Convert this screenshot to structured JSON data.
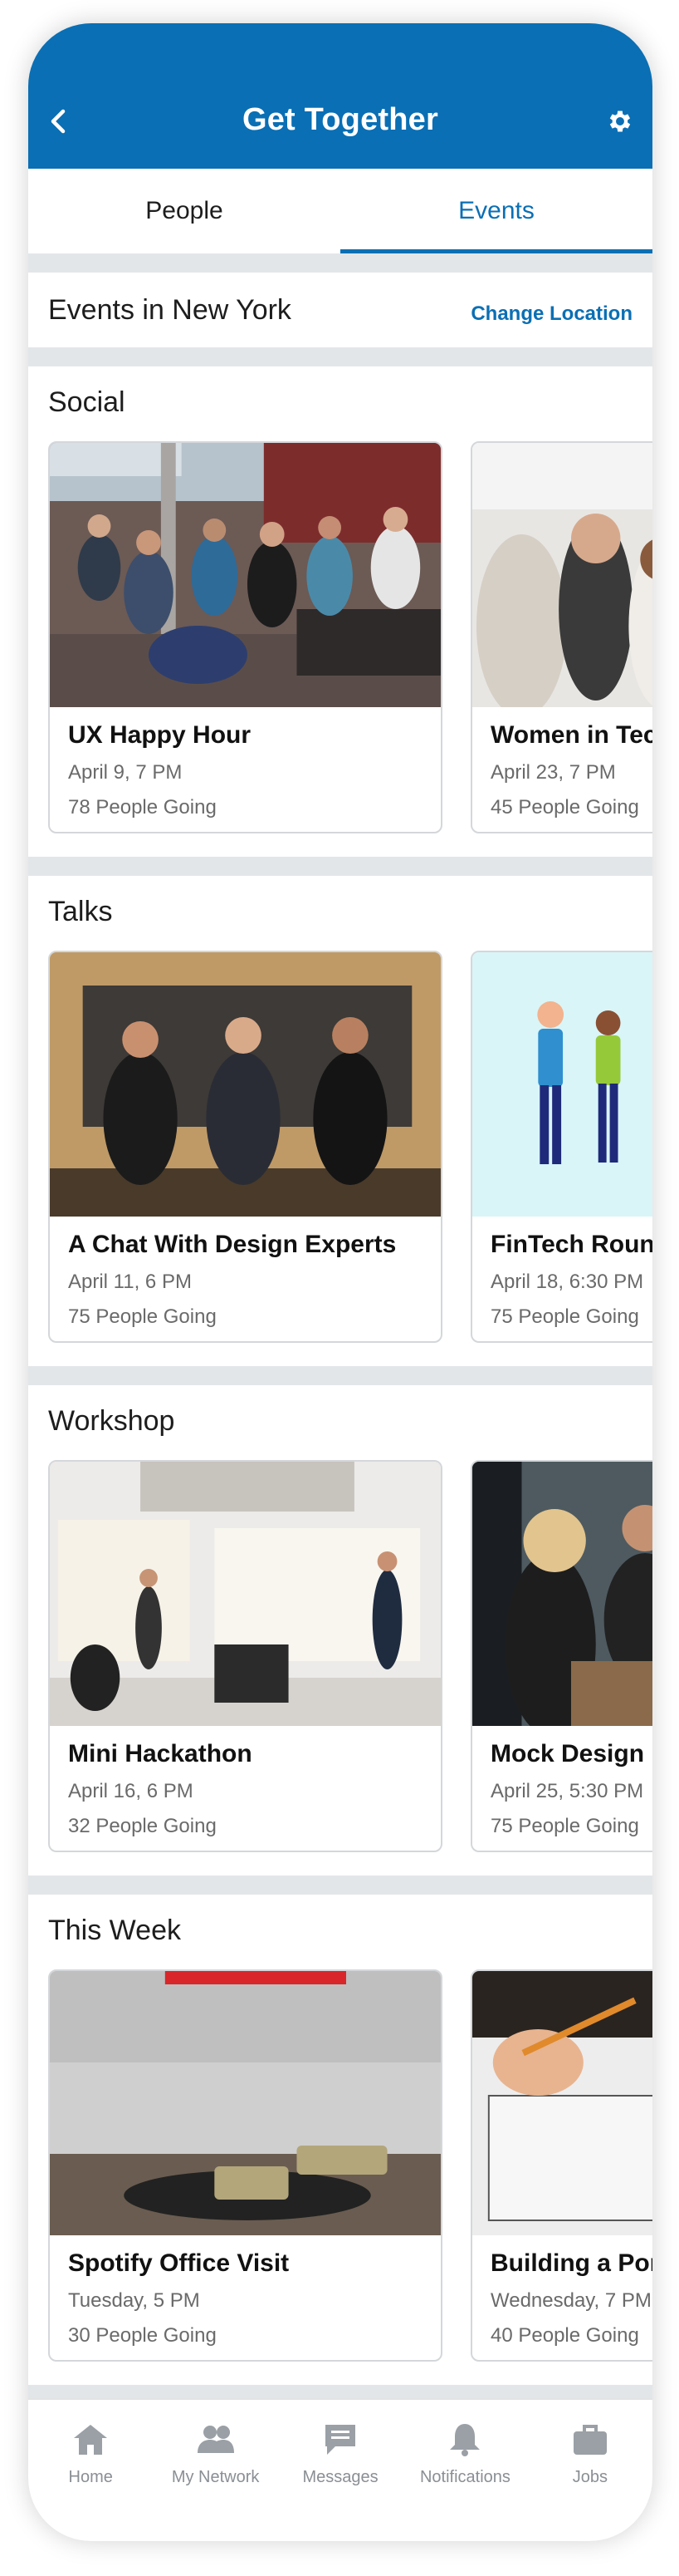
{
  "header": {
    "title": "Get Together"
  },
  "tabs": [
    {
      "label": "People"
    },
    {
      "label": "Events"
    }
  ],
  "location": {
    "label": "Events in New York",
    "change_label": "Change Location"
  },
  "sections": [
    {
      "title": "Social",
      "cards": [
        {
          "title": "UX Happy Hour",
          "date": "April 9, 7 PM",
          "going": "78 People Going"
        },
        {
          "title": "Women in Tec",
          "date": "April 23, 7 PM",
          "going": "45 People Going"
        }
      ]
    },
    {
      "title": "Talks",
      "cards": [
        {
          "title": "A Chat With Design Experts",
          "date": "April 11, 6 PM",
          "going": "75 People Going"
        },
        {
          "title": "FinTech Round",
          "date": "April 18, 6:30 PM",
          "going": "75 People Going"
        }
      ]
    },
    {
      "title": "Workshop",
      "cards": [
        {
          "title": "Mini Hackathon",
          "date": "April 16, 6 PM",
          "going": "32 People Going"
        },
        {
          "title": "Mock Design I",
          "date": "April 25, 5:30 PM",
          "going": "75 People Going"
        }
      ]
    },
    {
      "title": "This Week",
      "cards": [
        {
          "title": "Spotify Office Visit",
          "date": "Tuesday, 5 PM",
          "going": "30 People Going"
        },
        {
          "title": "Building a Por",
          "date": "Wednesday, 7 PM",
          "going": "40 People Going"
        }
      ]
    }
  ],
  "nav": [
    {
      "label": "Home",
      "icon": "home-icon"
    },
    {
      "label": "My Network",
      "icon": "people-icon"
    },
    {
      "label": "Messages",
      "icon": "message-icon"
    },
    {
      "label": "Notifications",
      "icon": "bell-icon"
    },
    {
      "label": "Jobs",
      "icon": "briefcase-icon"
    }
  ],
  "colors": {
    "brand": "#0a6fb4",
    "background": "#e3e6e9",
    "muted_text": "#6a6a6a"
  }
}
